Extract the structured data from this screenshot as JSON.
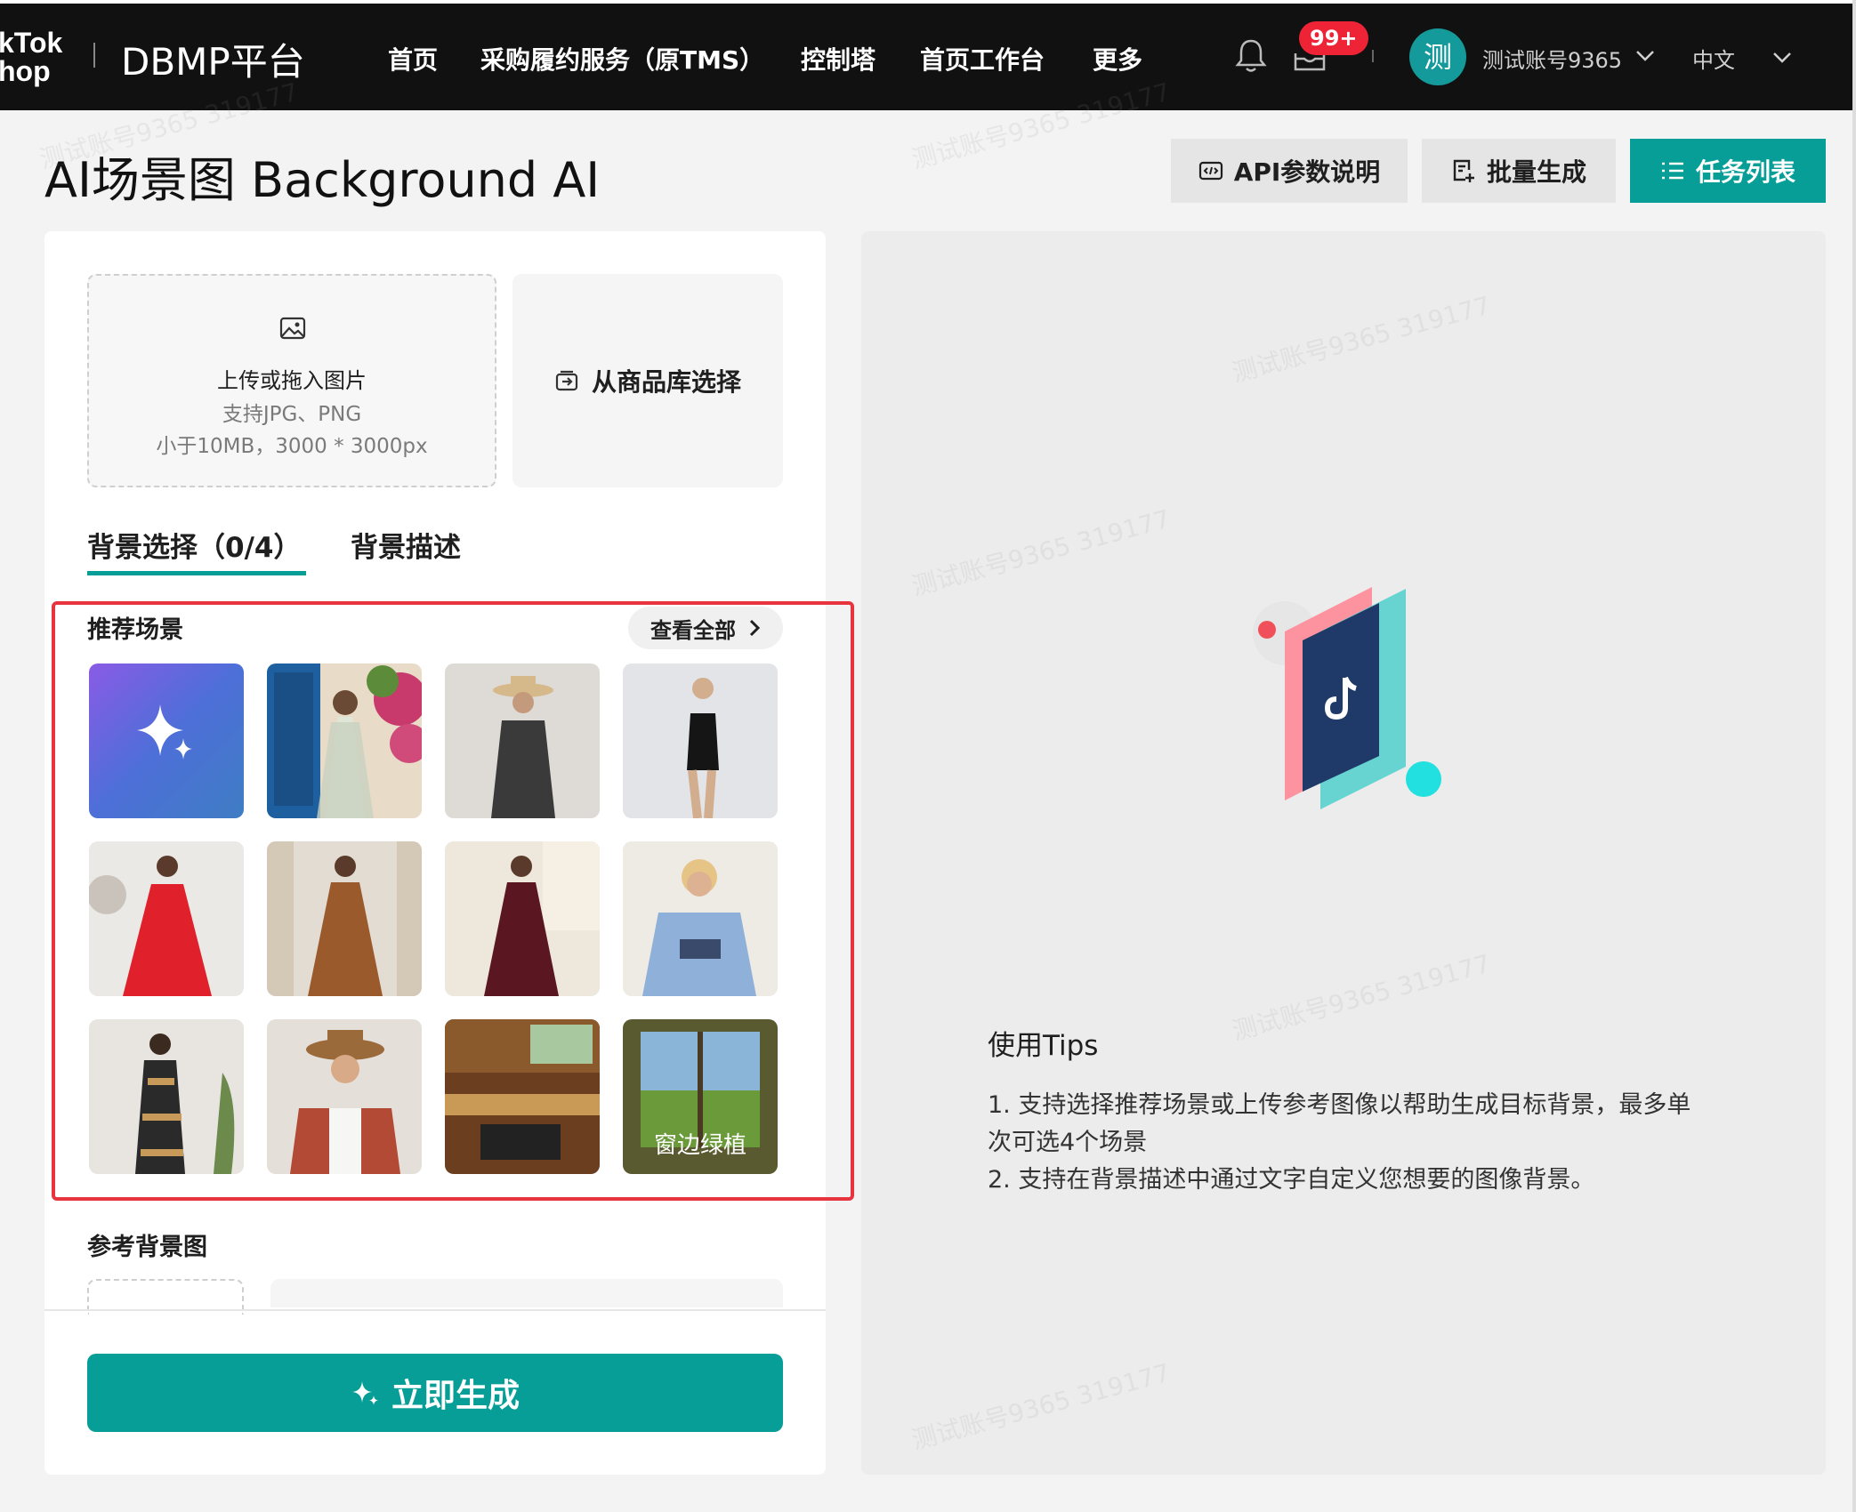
{
  "topbar": {
    "logo_line1": "kTok",
    "logo_line2": "hop",
    "platform": "DBMP平台",
    "nav": [
      "首页",
      "采购履约服务（原TMS）",
      "控制塔",
      "首页工作台",
      "更多"
    ],
    "badge": "99+",
    "avatar_char": "测",
    "account": "测试账号9365",
    "language": "中文"
  },
  "page": {
    "title": "AI场景图 Background AI",
    "buttons": {
      "api": "API参数说明",
      "batch": "批量生成",
      "tasks": "任务列表"
    }
  },
  "upload": {
    "title": "上传或拖入图片",
    "formats": "支持JPG、PNG",
    "limits": "小于10MB，3000 * 3000px",
    "library": "从商品库选择"
  },
  "tabs": {
    "selection": "背景选择（0/4）",
    "description": "背景描述"
  },
  "scenes": {
    "title": "推荐场景",
    "view_all": "查看全部",
    "last_caption": "窗边绿植"
  },
  "reference": {
    "title": "参考背景图"
  },
  "generate_label": "立即生成",
  "tips": {
    "title": "使用Tips",
    "items": [
      "1. 支持选择推荐场景或上传参考图像以帮助生成目标背景，最多单次可选4个场景",
      "2. 支持在背景描述中通过文字自定义您想要的图像背景。"
    ]
  },
  "watermark": "测试账号9365 319177",
  "colors": {
    "accent": "#069e96",
    "badge": "#ee2436",
    "highlight": "#e7343f"
  }
}
